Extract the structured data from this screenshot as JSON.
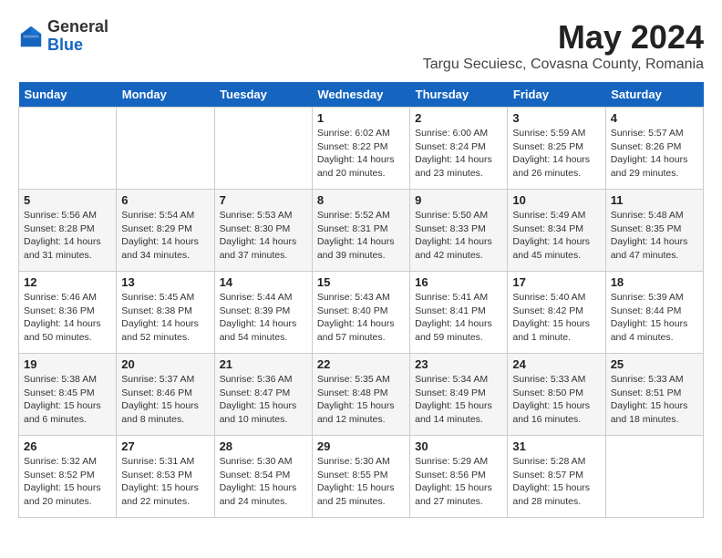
{
  "header": {
    "logo_general": "General",
    "logo_blue": "Blue",
    "month_year": "May 2024",
    "location": "Targu Secuiesc, Covasna County, Romania"
  },
  "days_of_week": [
    "Sunday",
    "Monday",
    "Tuesday",
    "Wednesday",
    "Thursday",
    "Friday",
    "Saturday"
  ],
  "weeks": [
    [
      {
        "day": "",
        "info": ""
      },
      {
        "day": "",
        "info": ""
      },
      {
        "day": "",
        "info": ""
      },
      {
        "day": "1",
        "info": "Sunrise: 6:02 AM\nSunset: 8:22 PM\nDaylight: 14 hours\nand 20 minutes."
      },
      {
        "day": "2",
        "info": "Sunrise: 6:00 AM\nSunset: 8:24 PM\nDaylight: 14 hours\nand 23 minutes."
      },
      {
        "day": "3",
        "info": "Sunrise: 5:59 AM\nSunset: 8:25 PM\nDaylight: 14 hours\nand 26 minutes."
      },
      {
        "day": "4",
        "info": "Sunrise: 5:57 AM\nSunset: 8:26 PM\nDaylight: 14 hours\nand 29 minutes."
      }
    ],
    [
      {
        "day": "5",
        "info": "Sunrise: 5:56 AM\nSunset: 8:28 PM\nDaylight: 14 hours\nand 31 minutes."
      },
      {
        "day": "6",
        "info": "Sunrise: 5:54 AM\nSunset: 8:29 PM\nDaylight: 14 hours\nand 34 minutes."
      },
      {
        "day": "7",
        "info": "Sunrise: 5:53 AM\nSunset: 8:30 PM\nDaylight: 14 hours\nand 37 minutes."
      },
      {
        "day": "8",
        "info": "Sunrise: 5:52 AM\nSunset: 8:31 PM\nDaylight: 14 hours\nand 39 minutes."
      },
      {
        "day": "9",
        "info": "Sunrise: 5:50 AM\nSunset: 8:33 PM\nDaylight: 14 hours\nand 42 minutes."
      },
      {
        "day": "10",
        "info": "Sunrise: 5:49 AM\nSunset: 8:34 PM\nDaylight: 14 hours\nand 45 minutes."
      },
      {
        "day": "11",
        "info": "Sunrise: 5:48 AM\nSunset: 8:35 PM\nDaylight: 14 hours\nand 47 minutes."
      }
    ],
    [
      {
        "day": "12",
        "info": "Sunrise: 5:46 AM\nSunset: 8:36 PM\nDaylight: 14 hours\nand 50 minutes."
      },
      {
        "day": "13",
        "info": "Sunrise: 5:45 AM\nSunset: 8:38 PM\nDaylight: 14 hours\nand 52 minutes."
      },
      {
        "day": "14",
        "info": "Sunrise: 5:44 AM\nSunset: 8:39 PM\nDaylight: 14 hours\nand 54 minutes."
      },
      {
        "day": "15",
        "info": "Sunrise: 5:43 AM\nSunset: 8:40 PM\nDaylight: 14 hours\nand 57 minutes."
      },
      {
        "day": "16",
        "info": "Sunrise: 5:41 AM\nSunset: 8:41 PM\nDaylight: 14 hours\nand 59 minutes."
      },
      {
        "day": "17",
        "info": "Sunrise: 5:40 AM\nSunset: 8:42 PM\nDaylight: 15 hours\nand 1 minute."
      },
      {
        "day": "18",
        "info": "Sunrise: 5:39 AM\nSunset: 8:44 PM\nDaylight: 15 hours\nand 4 minutes."
      }
    ],
    [
      {
        "day": "19",
        "info": "Sunrise: 5:38 AM\nSunset: 8:45 PM\nDaylight: 15 hours\nand 6 minutes."
      },
      {
        "day": "20",
        "info": "Sunrise: 5:37 AM\nSunset: 8:46 PM\nDaylight: 15 hours\nand 8 minutes."
      },
      {
        "day": "21",
        "info": "Sunrise: 5:36 AM\nSunset: 8:47 PM\nDaylight: 15 hours\nand 10 minutes."
      },
      {
        "day": "22",
        "info": "Sunrise: 5:35 AM\nSunset: 8:48 PM\nDaylight: 15 hours\nand 12 minutes."
      },
      {
        "day": "23",
        "info": "Sunrise: 5:34 AM\nSunset: 8:49 PM\nDaylight: 15 hours\nand 14 minutes."
      },
      {
        "day": "24",
        "info": "Sunrise: 5:33 AM\nSunset: 8:50 PM\nDaylight: 15 hours\nand 16 minutes."
      },
      {
        "day": "25",
        "info": "Sunrise: 5:33 AM\nSunset: 8:51 PM\nDaylight: 15 hours\nand 18 minutes."
      }
    ],
    [
      {
        "day": "26",
        "info": "Sunrise: 5:32 AM\nSunset: 8:52 PM\nDaylight: 15 hours\nand 20 minutes."
      },
      {
        "day": "27",
        "info": "Sunrise: 5:31 AM\nSunset: 8:53 PM\nDaylight: 15 hours\nand 22 minutes."
      },
      {
        "day": "28",
        "info": "Sunrise: 5:30 AM\nSunset: 8:54 PM\nDaylight: 15 hours\nand 24 minutes."
      },
      {
        "day": "29",
        "info": "Sunrise: 5:30 AM\nSunset: 8:55 PM\nDaylight: 15 hours\nand 25 minutes."
      },
      {
        "day": "30",
        "info": "Sunrise: 5:29 AM\nSunset: 8:56 PM\nDaylight: 15 hours\nand 27 minutes."
      },
      {
        "day": "31",
        "info": "Sunrise: 5:28 AM\nSunset: 8:57 PM\nDaylight: 15 hours\nand 28 minutes."
      },
      {
        "day": "",
        "info": ""
      }
    ]
  ]
}
